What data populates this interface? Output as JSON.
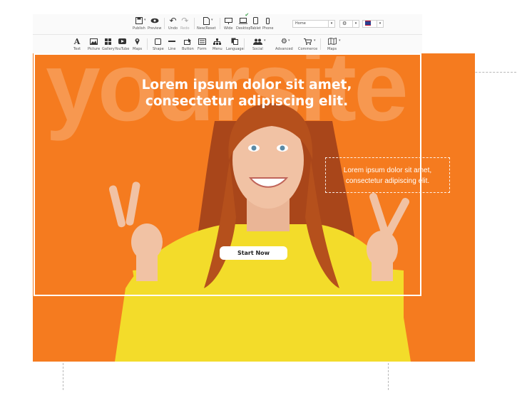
{
  "toolbar_top": {
    "publish": "Publish",
    "preview": "Preview",
    "undo": "Undo",
    "redo": "Redo",
    "new_reset": "New/Reset",
    "devices": [
      "Wide",
      "Desktop",
      "Tablet",
      "Phone"
    ],
    "page_select": "Home"
  },
  "toolbar_insert": {
    "items": [
      "Text",
      "Picture",
      "Gallery",
      "YouTube",
      "Maps",
      "Shape",
      "Line",
      "Button",
      "Form",
      "Menu",
      "Language",
      "Social",
      "Advanced",
      "Commerce",
      "Maps"
    ]
  },
  "hero": {
    "watermark": "yoursite",
    "headline": "Lorem ipsum dolor sit amet,\nconsectetur adipiscing elit.",
    "side_text": "Lorem ipsum dolor sit amet,\nconsectetur adipiscing elit.",
    "cta_label": "Start Now"
  },
  "colors": {
    "accent": "#f57b1f",
    "sweater": "#f3dc2a",
    "hair": "#b5501c",
    "skin": "#f1c2a4"
  }
}
